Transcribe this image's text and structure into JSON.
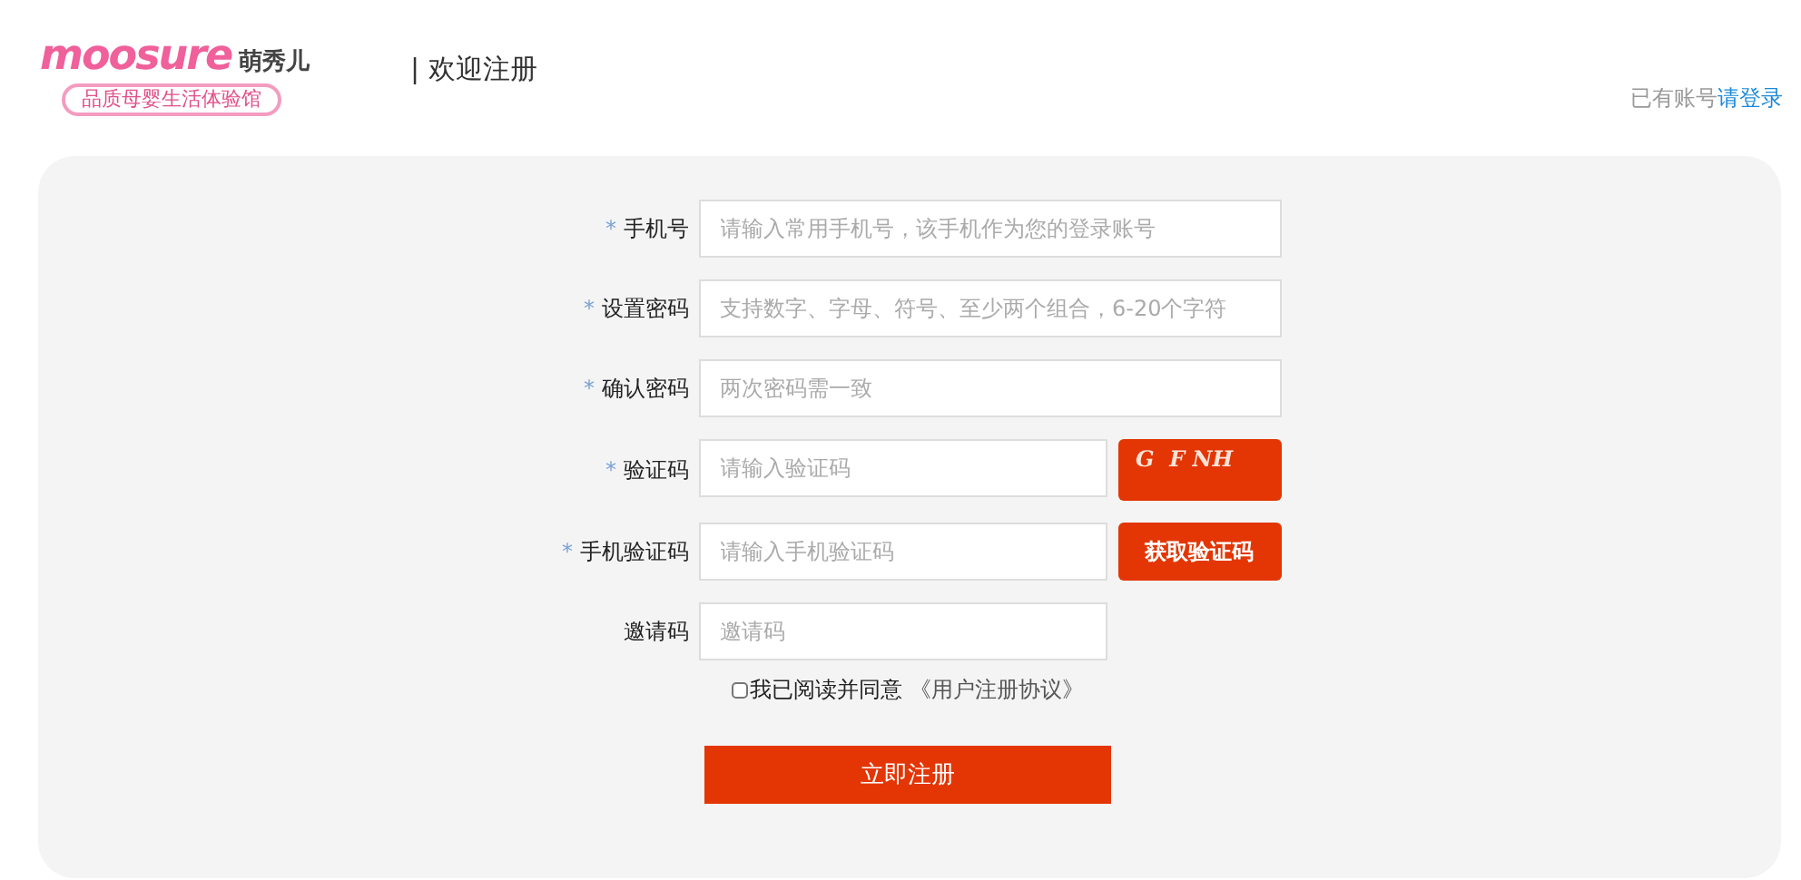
{
  "header": {
    "logo_text": "moosure",
    "logo_name": "萌秀儿",
    "logo_tagline": "品质母婴生活体验馆",
    "page_title": "| 欢迎注册",
    "login_prompt": "已有账号",
    "login_link": "请登录"
  },
  "fields": [
    {
      "label": "手机号",
      "required": true,
      "placeholder": "请输入常用手机号，该手机作为您的登录账号",
      "kind": "wide"
    },
    {
      "label": "设置密码",
      "required": true,
      "placeholder": "支持数字、字母、符号、至少两个组合，6-20个字符",
      "kind": "wide"
    },
    {
      "label": "确认密码",
      "required": true,
      "placeholder": "两次密码需一致",
      "kind": "wide"
    },
    {
      "label": "验证码",
      "required": true,
      "placeholder": "请输入验证码",
      "kind": "captcha",
      "captcha": "G  F NH"
    },
    {
      "label": "手机验证码",
      "required": true,
      "placeholder": "请输入手机验证码",
      "kind": "sms",
      "button": "获取验证码"
    },
    {
      "label": "邀请码",
      "required": false,
      "placeholder": "邀请码",
      "kind": "narrow"
    }
  ],
  "required_mark": "*",
  "agreement": {
    "checked": false,
    "text": "我已阅读并同意",
    "link": "《用户注册协议》"
  },
  "submit": "立即注册"
}
